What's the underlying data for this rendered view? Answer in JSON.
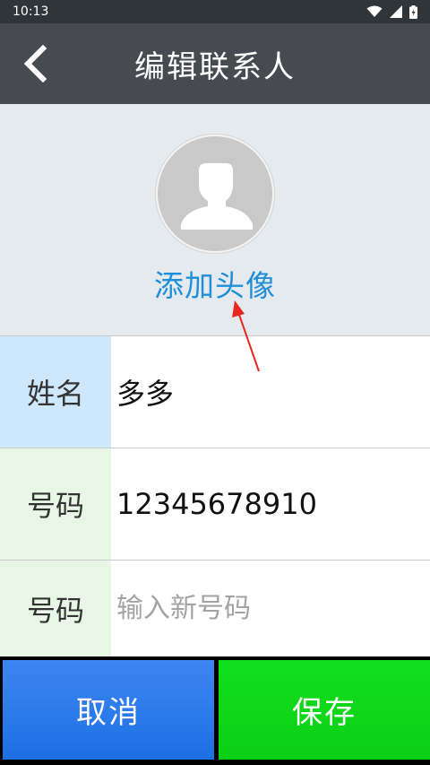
{
  "status_bar": {
    "time": "10:13"
  },
  "header": {
    "title": "编辑联系人",
    "back_icon": "chevron-left-icon"
  },
  "avatar": {
    "icon": "person-silhouette-icon",
    "link_label": "添加头像"
  },
  "form": {
    "name": {
      "label": "姓名",
      "value": "多多"
    },
    "phone": {
      "label": "号码",
      "value": "12345678910"
    },
    "new_phone": {
      "label": "号码",
      "placeholder": "输入新号码"
    }
  },
  "buttons": {
    "cancel_label": "取消",
    "save_label": "保存"
  },
  "colors": {
    "status_bar": "#303539",
    "app_bar": "#474b51",
    "avatar_area": "#e5eaee",
    "link": "#1e8fd8",
    "name_label_bg": "#cfe7fb",
    "phone_label_bg": "#e8f6e5",
    "cancel": "#2a78ea",
    "save": "#10d81a"
  }
}
